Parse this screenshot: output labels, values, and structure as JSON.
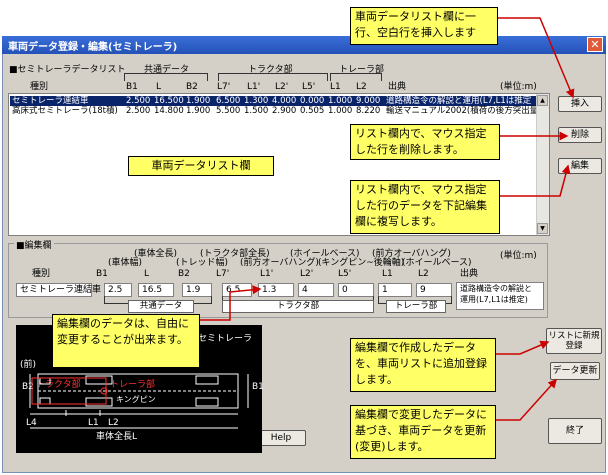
{
  "window": {
    "title": "車両データ登録・編集(セミトレーラ)",
    "close_symbol": "✕"
  },
  "list_section": {
    "title": "■セミトレーラデータリスト",
    "group_common": "共通データ",
    "group_tractor": "トラクタ部",
    "group_trailer": "トレーラ部",
    "col_type": "種別",
    "col_b1": "B1",
    "col_l": "L",
    "col_b2": "B2",
    "col_l7": "L7'",
    "col_l1p": "L1'",
    "col_l2p": "L2'",
    "col_l5p": "L5'",
    "col_l1": "L1",
    "col_l2": "L2",
    "col_source": "出典",
    "unit": "(単位:m)",
    "rows": [
      {
        "name": "セミトレーラ連結車",
        "b1": "2.500",
        "l": "16.500",
        "b2": "1.900",
        "l7": "6.500",
        "l1p": "1.300",
        "l2p": "4.000",
        "l5p": "0.000",
        "l1": "1.000",
        "l2": "9.000",
        "source": "道路構造令の解説と運用(L7,L1は推定"
      },
      {
        "name": "高床式セミトレーラ(18t積)",
        "b1": "2.500",
        "l": "14.800",
        "b2": "1.900",
        "l7": "5.500",
        "l1p": "1.500",
        "l2p": "2.900",
        "l5p": "0.505",
        "l1": "1.000",
        "l2": "8.220",
        "source": "輸送マニュアル2002(積荷の後方突出量"
      }
    ]
  },
  "edit_section": {
    "title": "■編集欄",
    "hdr_overall": "(車体全長)",
    "hdr_width": "(車体幅)",
    "hdr_tread": "(トレッド幅)",
    "hdr_tractor_len": "(トラクタ部全長)",
    "hdr_wheelbase": "(ホイールベース)",
    "hdr_front_oh": "(前方オーバハング)",
    "hdr_kingpin": "(キングピン~後輪軸)",
    "hdr_front_oh2": "(前方オーバハング)",
    "hdr_wheelbase2": "(ホイールベース)",
    "unit": "(単位:m)",
    "col_type": "種別",
    "col_b1": "B1",
    "col_l": "L",
    "col_b2": "B2",
    "col_l7": "L7'",
    "col_l1p": "L1'",
    "col_l2p": "L2'",
    "col_l5p": "L5'",
    "col_l1": "L1",
    "col_l2": "L2",
    "col_source": "出典",
    "values": {
      "type": "セミトレーラ連結車",
      "b1": "2.5",
      "l": "16.5",
      "b2": "1.9",
      "l7": "6.5",
      "l1p": "1.3",
      "l2p": "4",
      "l5p": "0",
      "l1": "1",
      "l2": "9"
    },
    "source_line1": "道路構造令の解説と",
    "source_line2": "運用(L7,L1は推定)",
    "group_common": "共通データ",
    "group_tractor": "トラクタ部",
    "group_trailer": "トレーラ部"
  },
  "buttons": {
    "insert": "挿入",
    "delete": "削除",
    "edit": "編集",
    "add_to_list_line1": "リストに新規",
    "add_to_list_line2": "登録",
    "update": "データ更新",
    "help": "Help",
    "close": "終了"
  },
  "diagram": {
    "title": "セミトレーラ",
    "front": "(前)",
    "label_b2": "B2",
    "label_b1": "B1",
    "label_tractor": "トラクタ部",
    "label_trailer": "トレーラ部",
    "label_kingpin": "キングピン",
    "label_l4": "L4",
    "label_l1": "L1",
    "label_l2": "L2",
    "label_total": "車体全長L"
  },
  "callouts": {
    "top": "車両データリスト欄に一行、空白行を挿入します",
    "list_area": "車両データリスト欄",
    "delete": "リスト欄内で、マウス指定した行を削除します。",
    "edit": "リスト欄内で、マウス指定した行のデータを下記編集欄に複写します。",
    "free_edit": "編集欄のデータは、自由に変更することが出来ます。",
    "add": "編集欄で作成したデータを、車両リストに追加登録します。",
    "update": "編集欄で変更したデータに基づき、車両データを更新(変更)します。"
  },
  "colors": {
    "titlebar": "#2451b8",
    "callout_fill": "#ffff66",
    "arrow": "#cc0000",
    "selected_row": "#0a246a",
    "dialog_bg": "#d4d0c8"
  }
}
